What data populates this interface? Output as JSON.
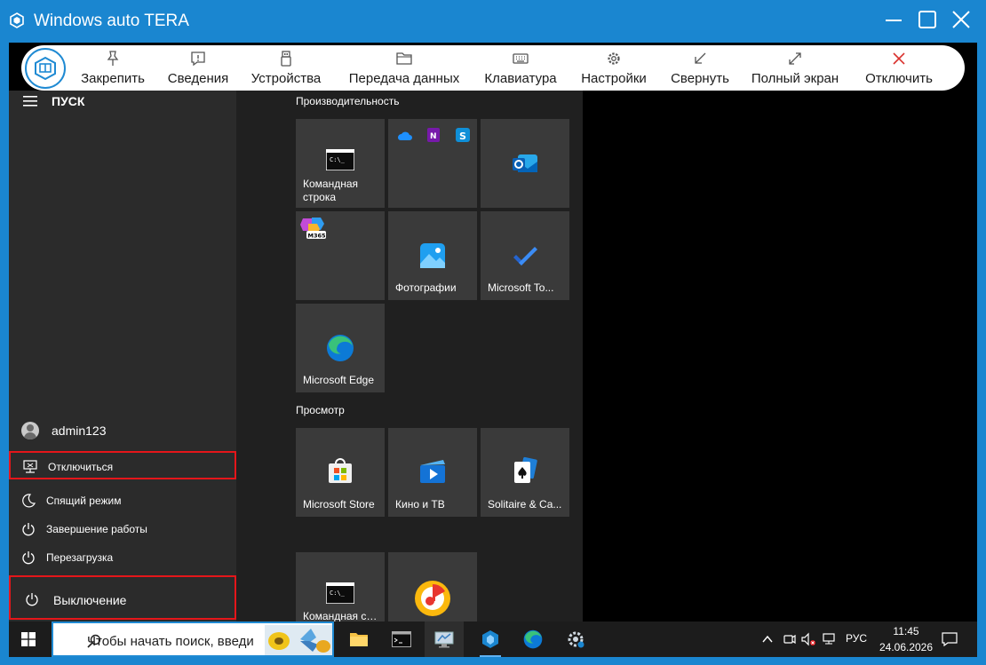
{
  "window": {
    "title": "Windows auto TERA"
  },
  "toolbar": {
    "buttons": [
      {
        "label": "Закрепить",
        "icon": "pin-icon"
      },
      {
        "label": "Сведения",
        "icon": "info-icon"
      },
      {
        "label": "Устройства",
        "icon": "usb-icon"
      },
      {
        "label": "Передача данных",
        "icon": "folder-icon"
      },
      {
        "label": "Клавиатура",
        "icon": "keyboard-icon"
      },
      {
        "label": "Настройки",
        "icon": "gear-icon"
      },
      {
        "label": "Свернуть",
        "icon": "minimize-arrow-icon"
      },
      {
        "label": "Полный экран",
        "icon": "fullscreen-icon"
      },
      {
        "label": "Отключить",
        "icon": "close-icon",
        "color": "#d9302c"
      }
    ]
  },
  "start_menu": {
    "title": "ПУСК",
    "user": "admin123",
    "items": [
      {
        "label": "Отключиться",
        "icon": "disconnect-icon",
        "highlighted": true
      },
      {
        "label": "Спящий режим",
        "icon": "moon-icon",
        "highlighted": false
      },
      {
        "label": "Завершение работы",
        "icon": "power-icon",
        "highlighted": false
      },
      {
        "label": "Перезагрузка",
        "icon": "power-icon",
        "highlighted": false
      }
    ],
    "power": {
      "label": "Выключение",
      "icon": "power-icon",
      "highlighted": true
    },
    "groups": [
      {
        "title": "Производительность",
        "tiles": [
          {
            "label": "Командная строка",
            "icon": "cmd-icon"
          },
          {
            "label": "",
            "icon": "office-apps-icon"
          },
          {
            "label": "",
            "icon": "outlook-icon"
          },
          {
            "label": "",
            "icon": "m365-icon",
            "badge": "M365"
          },
          {
            "label": "Фотографии",
            "icon": "photos-icon"
          },
          {
            "label": "Microsoft To...",
            "icon": "todo-icon"
          },
          {
            "label": "Microsoft Edge",
            "icon": "edge-icon"
          }
        ]
      },
      {
        "title": "Просмотр",
        "tiles": [
          {
            "label": "Microsoft Store",
            "icon": "store-icon"
          },
          {
            "label": "Кино и ТВ",
            "icon": "movies-icon"
          },
          {
            "label": "Solitaire & Ca...",
            "icon": "solitaire-icon"
          },
          {
            "label": "Командная строка",
            "icon": "cmd-icon"
          },
          {
            "label": "",
            "icon": "music-icon"
          }
        ]
      }
    ]
  },
  "taskbar": {
    "search_placeholder": "Чтобы начать поиск, введи",
    "language": "РУС",
    "time": "11:45",
    "date": "24.06.2026"
  },
  "colors": {
    "accent": "#1a86d0",
    "highlight_border": "#e5161a"
  }
}
